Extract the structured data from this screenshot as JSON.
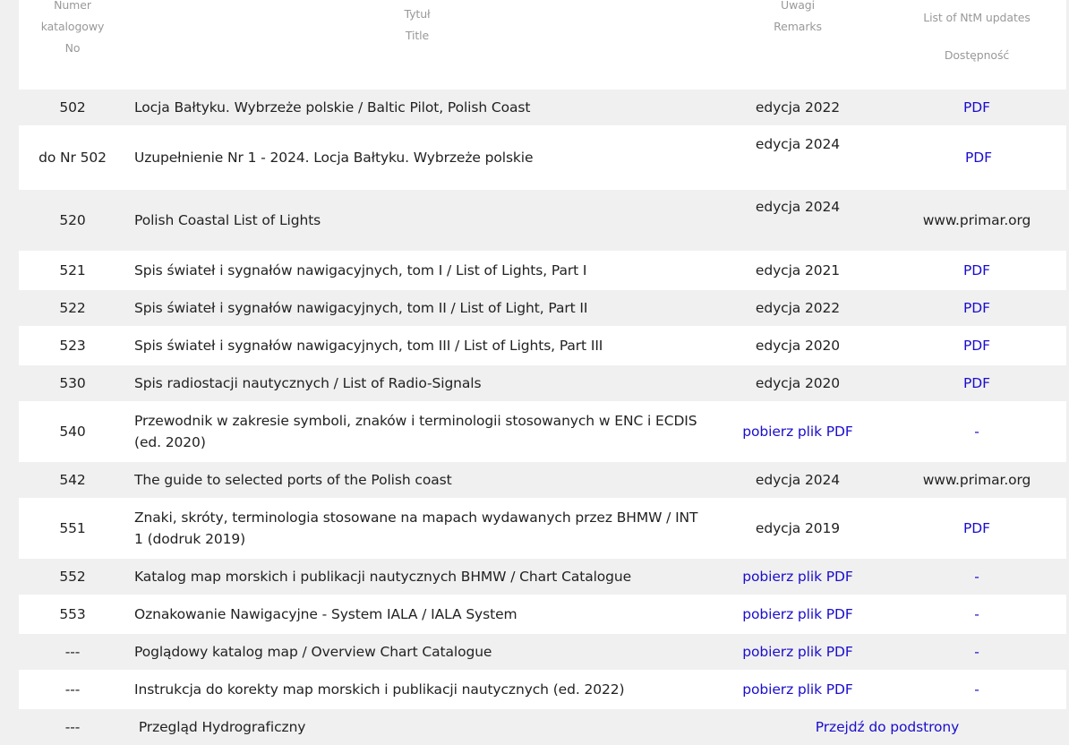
{
  "header": {
    "col1_line1": "Numer",
    "col1_line2": "katalogowy",
    "col1_line3": "No",
    "col2_line1": "Tytuł",
    "col2_line2": "Title",
    "col3_line1": "Uwagi",
    "col3_line2": "Remarks",
    "col4_line1": "List of NtM updates",
    "col4_line2": "Dostępność"
  },
  "rows": [
    {
      "no": "502",
      "title": "Locja Bałtyku. Wybrzeże polskie  / Baltic Pilot, Polish Coast",
      "remarks": "edycja 2022",
      "avail": "PDF"
    },
    {
      "no": "do Nr 502",
      "title": "Uzupełnienie Nr 1 - 2024. Locja Bałtyku. Wybrzeże polskie",
      "remarks": "edycja 2024",
      "avail": "PDF"
    },
    {
      "no": "520",
      "title": "Polish Coastal List of Lights",
      "remarks": "edycja 2024",
      "avail": "www.primar.org"
    },
    {
      "no": "521",
      "title": "Spis świateł i sygnałów nawigacyjnych, tom I / List of Lights, Part I",
      "remarks": "edycja 2021",
      "avail": "PDF"
    },
    {
      "no": "522",
      "title": "Spis świateł i sygnałów nawigacyjnych, tom II / List of Light, Part II",
      "remarks": "edycja 2022",
      "avail": "PDF"
    },
    {
      "no": "523",
      "title": "Spis świateł i sygnałów nawigacyjnych, tom III / List of Lights, Part III",
      "remarks": "edycja 2020",
      "avail": "PDF"
    },
    {
      "no": "530",
      "title": "Spis radiostacji nautycznych / List of Radio-Signals",
      "remarks": "edycja 2020",
      "avail": "PDF"
    },
    {
      "no": "540",
      "title": "Przewodnik w zakresie symboli, znaków i terminologii stosowanych w ENC i ECDIS (ed. 2020)",
      "remarks": "pobierz plik PDF",
      "avail": "-"
    },
    {
      "no": "542",
      "title": "The guide to selected ports of the Polish coast",
      "remarks": "edycja 2024",
      "avail": "www.primar.org"
    },
    {
      "no": "551",
      "title": "Znaki, skróty, terminologia stosowane na mapach wydawanych przez BHMW / INT 1 (dodruk 2019)",
      "remarks": "edycja 2019",
      "avail": "PDF"
    },
    {
      "no": "552",
      "title": "Katalog map morskich i publikacji nautycznych BHMW / Chart Catalogue",
      "remarks": "pobierz plik PDF",
      "avail": "-"
    },
    {
      "no": "553",
      "title": "Oznakowanie Nawigacyjne - System IALA / IALA System",
      "remarks": "pobierz plik PDF",
      "avail": "-"
    },
    {
      "no": "---",
      "title": "Poglądowy katalog map / Overview Chart Catalogue",
      "remarks": "pobierz plik PDF",
      "avail": "-"
    },
    {
      "no": "---",
      "title": "Instrukcja do korekty map morskich i publikacji nautycznych (ed. 2022)",
      "remarks": "pobierz plik PDF",
      "avail": "-"
    },
    {
      "no": "---",
      "title": " Przegląd Hydrograficzny",
      "merged": "Przejdź do podstrony"
    }
  ]
}
